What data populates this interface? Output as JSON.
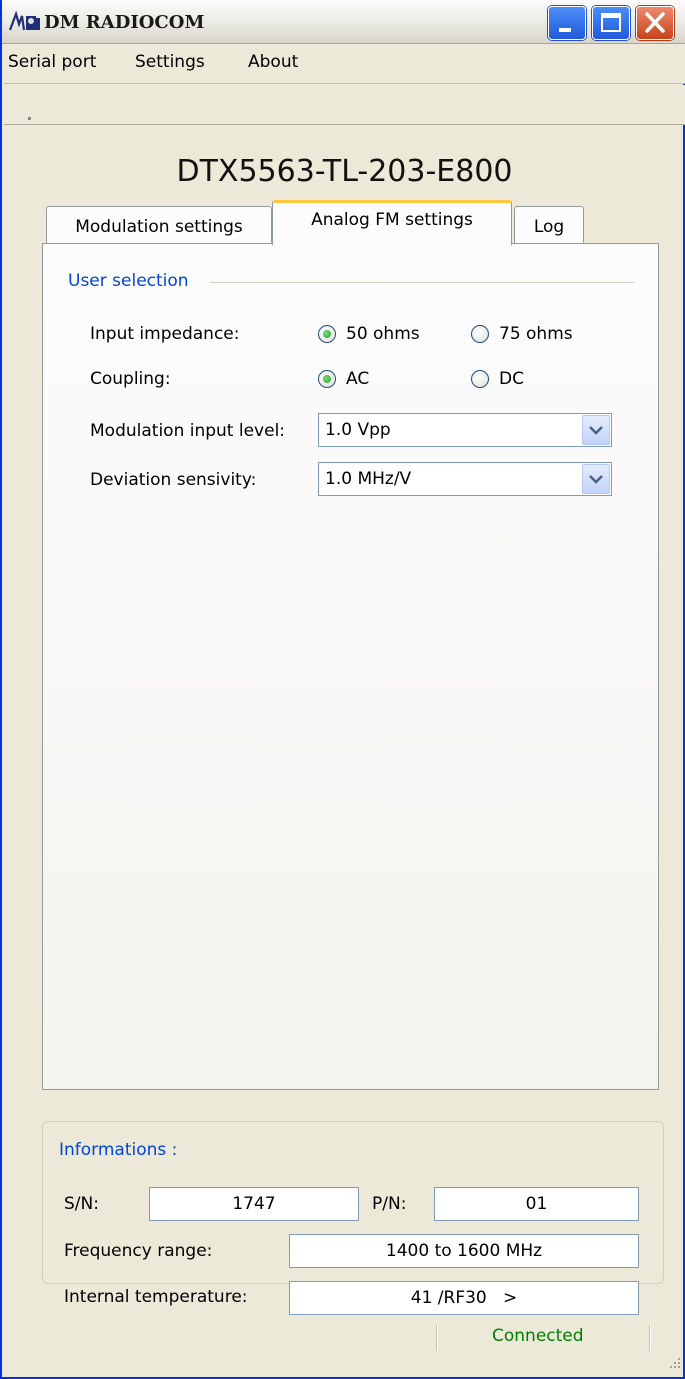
{
  "window": {
    "title": "DM RADIOCOM"
  },
  "menu": {
    "items": [
      "Serial port",
      "Settings",
      "About"
    ]
  },
  "device": {
    "title": "DTX5563-TL-203-E800"
  },
  "tabs": [
    "Modulation settings",
    "Analog FM settings",
    "Log"
  ],
  "active_tab": "Analog FM settings",
  "user_selection": {
    "legend": "User selection",
    "input_impedance": {
      "label": "Input impedance:",
      "options": [
        "50 ohms",
        "75 ohms"
      ],
      "selected": "50 ohms"
    },
    "coupling": {
      "label": "Coupling:",
      "options": [
        "AC",
        "DC"
      ],
      "selected": "AC"
    },
    "modulation_input_level": {
      "label": "Modulation input level:",
      "value": "1.0 Vpp"
    },
    "deviation_sensivity": {
      "label": "Deviation sensivity:",
      "value": "1.0 MHz/V"
    }
  },
  "informations": {
    "legend": "Informations :",
    "sn": {
      "label": "S/N:",
      "value": "1747"
    },
    "pn": {
      "label": "P/N:",
      "value": "01"
    },
    "frequency_range": {
      "label": "Frequency range:",
      "value": "1400 to 1600 MHz"
    },
    "internal_temperature": {
      "label": "Internal temperature:",
      "value": "41 /RF30   >"
    }
  },
  "status": {
    "text": "Connected",
    "color": "#008000"
  },
  "colors": {
    "accent": "#0046d5",
    "tab_highlight": "#ffc83c",
    "close_button": "#c9401b"
  }
}
